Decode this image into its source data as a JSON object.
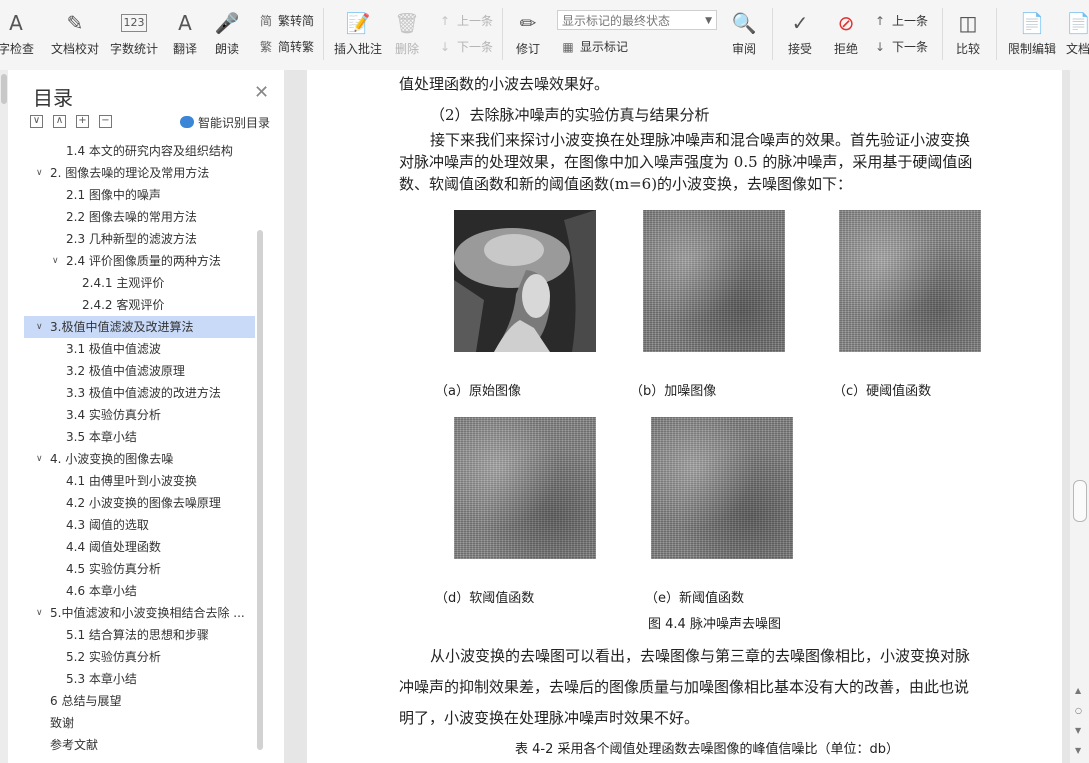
{
  "ribbon": {
    "check": "字检查",
    "proofread": "文档校对",
    "word_count": "字数统计",
    "translate": "翻译",
    "read_aloud": "朗读",
    "to_traditional": "繁转简",
    "to_simplified": "简转繁",
    "insert_comment": "插入批注",
    "delete": "删除",
    "prev_item": "上一条",
    "next_item": "下一条",
    "track": "修订",
    "show_dropdown": "显示标记的最终状态",
    "show_marks": "显示标记",
    "review": "审阅",
    "accept": "接受",
    "reject": "拒绝",
    "prev": "上一条",
    "next": "下一条",
    "compare": "比较",
    "restrict": "限制编辑",
    "doc_more": "文档"
  },
  "sidebar": {
    "title": "目录",
    "ai_label": "智能识别目录",
    "items": [
      {
        "label": "1.4  本文的研究内容及组织结构",
        "indent": 2,
        "arrow": ""
      },
      {
        "label": "2.  图像去噪的理论及常用方法",
        "indent": 1,
        "arrow": "v"
      },
      {
        "label": "2.1 图像中的噪声",
        "indent": 2,
        "arrow": ""
      },
      {
        "label": "2.2  图像去噪的常用方法",
        "indent": 2,
        "arrow": ""
      },
      {
        "label": "2.3 几种新型的滤波方法",
        "indent": 2,
        "arrow": ""
      },
      {
        "label": "2.4  评价图像质量的两种方法",
        "indent": 2,
        "arrow": "v"
      },
      {
        "label": "2.4.1 主观评价",
        "indent": 3,
        "arrow": ""
      },
      {
        "label": "2.4.2 客观评价",
        "indent": 3,
        "arrow": ""
      },
      {
        "label": "3.极值中值滤波及改进算法",
        "indent": 1,
        "arrow": "v",
        "selected": true
      },
      {
        "label": "3.1 极值中值滤波",
        "indent": 2,
        "arrow": ""
      },
      {
        "label": "3.2 极值中值滤波原理",
        "indent": 2,
        "arrow": ""
      },
      {
        "label": "3.3 极值中值滤波的改进方法",
        "indent": 2,
        "arrow": ""
      },
      {
        "label": "3.4 实验仿真分析",
        "indent": 2,
        "arrow": ""
      },
      {
        "label": "3.5 本章小结",
        "indent": 2,
        "arrow": ""
      },
      {
        "label": "4.  小波变换的图像去噪",
        "indent": 1,
        "arrow": "v"
      },
      {
        "label": "4.1 由傅里叶到小波变换",
        "indent": 2,
        "arrow": ""
      },
      {
        "label": "4.2 小波变换的图像去噪原理",
        "indent": 2,
        "arrow": ""
      },
      {
        "label": "4.3 阈值的选取",
        "indent": 2,
        "arrow": ""
      },
      {
        "label": "4.4 阈值处理函数",
        "indent": 2,
        "arrow": ""
      },
      {
        "label": "4.5  实验仿真分析",
        "indent": 2,
        "arrow": ""
      },
      {
        "label": "4.6 本章小结",
        "indent": 2,
        "arrow": ""
      },
      {
        "label": "5.中值滤波和小波变换相结合去除 ...",
        "indent": 1,
        "arrow": "v"
      },
      {
        "label": "5.1 结合算法的思想和步骤",
        "indent": 2,
        "arrow": ""
      },
      {
        "label": "5.2 实验仿真分析",
        "indent": 2,
        "arrow": ""
      },
      {
        "label": "5.3 本章小结",
        "indent": 2,
        "arrow": ""
      },
      {
        "label": "6 总结与展望",
        "indent": 1,
        "arrow": ""
      },
      {
        "label": "致谢",
        "indent": 1,
        "arrow": ""
      },
      {
        "label": "参考文献",
        "indent": 1,
        "arrow": ""
      }
    ]
  },
  "doc": {
    "line0": "值处理函数的小波去噪效果好。",
    "heading": "（2）去除脉冲噪声的实验仿真与结果分析",
    "p1_l1": "接下来我们来探讨小波变换在处理脉冲噪声和混合噪声的效果。首先验证小波变换",
    "p1_l2": "对脉冲噪声的处理效果，在图像中加入噪声强度为 0.5 的脉冲噪声，采用基于硬阈值函",
    "p1_l3": "数、软阈值函数和新的阈值函数(m=6)的小波变换，去噪图像如下：",
    "cap_a": "（a）原始图像",
    "cap_b": "（b）加噪图像",
    "cap_c": "（c）硬阈值函数",
    "cap_d": "（d）软阈值函数",
    "cap_e": "（e）新阈值函数",
    "fig_title": "图 4.4  脉冲噪声去噪图",
    "p2_l1": "从小波变换的去噪图可以看出，去噪图像与第三章的去噪图像相比，小波变换对脉",
    "p2_l2": "冲噪声的抑制效果差，去噪后的图像质量与加噪图像相比基本没有大的改善，由此也说",
    "p2_l3": "明了，小波变换在处理脉冲噪声时效果不好。",
    "table_title": "表 4-2 采用各个阈值处理函数去噪图像的峰值信噪比（单位：db）"
  }
}
